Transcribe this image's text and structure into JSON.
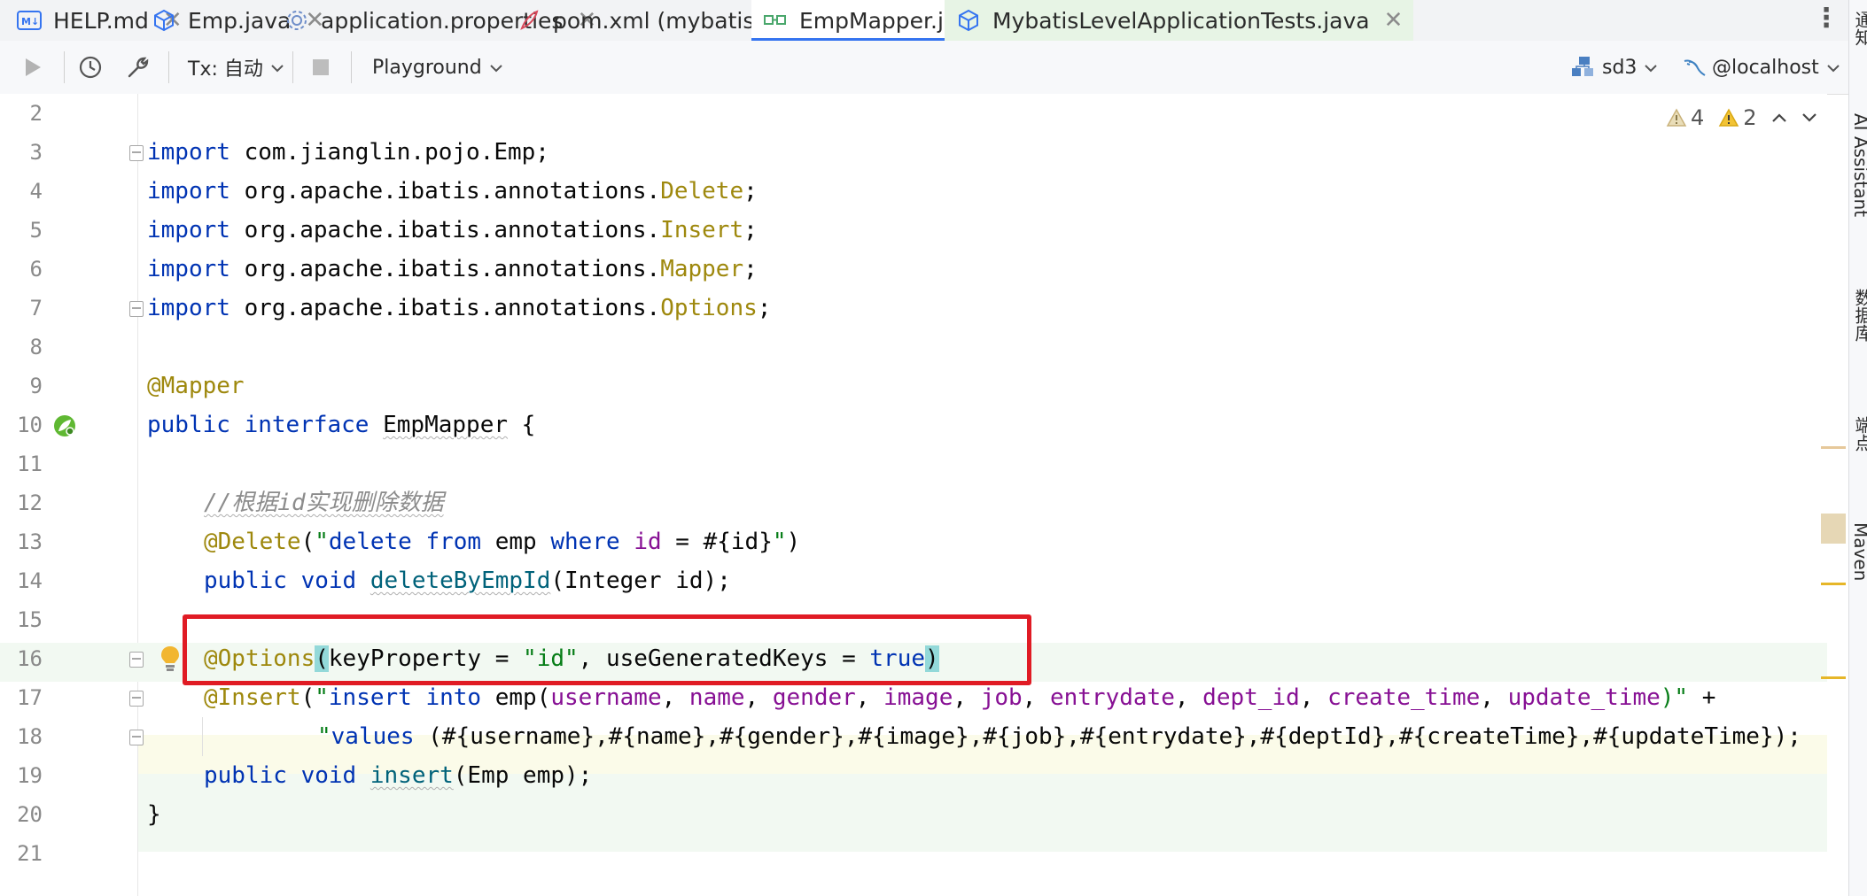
{
  "tabs": [
    {
      "label": "HELP.md",
      "icon": "markdown-file-icon"
    },
    {
      "label": "Emp.java",
      "icon": "java-class-icon"
    },
    {
      "label": "application.properties",
      "icon": "settings-file-icon"
    },
    {
      "label": "pom.xml (mybatisLevel)",
      "icon": "maven-pom-icon"
    },
    {
      "label": "EmpMapper.java",
      "icon": "java-interface-icon",
      "active": true
    },
    {
      "label": "MybatisLevelApplicationTests.java",
      "icon": "java-test-class-icon"
    }
  ],
  "toolbar": {
    "tx_label": "Tx: 自动",
    "playground_label": "Playground",
    "datasource_label": "sd3",
    "host_label": "@localhost"
  },
  "inspections": {
    "warnings_gray": "4",
    "warnings_yellow": "2"
  },
  "editor": {
    "line_numbers": [
      "2",
      "3",
      "4",
      "5",
      "6",
      "7",
      "8",
      "9",
      "10",
      "11",
      "12",
      "13",
      "14",
      "15",
      "16",
      "17",
      "18",
      "19",
      "20",
      "21"
    ],
    "lines": {
      "l3": {
        "kw": "import",
        "rest": " com.jianglin.pojo.Emp;"
      },
      "l4": {
        "kw": "import",
        "pkg": " org.apache.ibatis.annotations.",
        "cls": "Delete",
        "semi": ";"
      },
      "l5": {
        "kw": "import",
        "pkg": " org.apache.ibatis.annotations.",
        "cls": "Insert",
        "semi": ";"
      },
      "l6": {
        "kw": "import",
        "pkg": " org.apache.ibatis.annotations.",
        "cls": "Mapper",
        "semi": ";"
      },
      "l7": {
        "kw": "import",
        "pkg": " org.apache.ibatis.annotations.",
        "cls": "Options",
        "semi": ";"
      },
      "l9": {
        "ann": "@Mapper"
      },
      "l10": {
        "kw1": "public",
        "kw2": "interface",
        "name": "EmpMapper",
        "brace": " {"
      },
      "l12": {
        "comment": "//根据id实现删除数据"
      },
      "l13": {
        "ann": "@Delete",
        "p1": "(",
        "q1": "\"",
        "s1": "delete",
        "s2": "from",
        "s3": " emp ",
        "s4": "where",
        "s5": "id",
        "s6": " = #{id}",
        "q2": "\"",
        "p2": ")"
      },
      "l14": {
        "kw1": "public",
        "kw2": "void",
        "name": "deleteByEmpId",
        "rest": "(Integer id);"
      },
      "l16": {
        "ann": "@Options",
        "p1": "(",
        "args": "keyProperty = ",
        "str": "\"id\"",
        "args2": ", useGeneratedKeys = ",
        "kw": "true",
        "p2": ")"
      },
      "l17": {
        "ann": "@Insert",
        "p1": "(",
        "q": "\"",
        "kw1": "insert",
        "kw2": "into",
        "tbl": " emp(",
        "cols": [
          "username",
          "name",
          "gender",
          "image",
          "job",
          "entrydate",
          "dept_id",
          "create_time",
          "update_time"
        ],
        "end": ")\"",
        "plus": " +"
      },
      "l18": {
        "q": "\"",
        "kw": "values",
        "rest": " (#{username},#{name},#{gender},#{image},#{job},#{entrydate},#{deptId},#{createTime},#{updateTime});"
      },
      "l19": {
        "kw1": "public",
        "kw2": "void",
        "name": "insert",
        "rest": "(Emp emp);"
      },
      "l20": {
        "brace": "}"
      }
    }
  },
  "right_strip": [
    "通知",
    "AI Assistant",
    "数据库",
    "端点",
    "Maven"
  ]
}
